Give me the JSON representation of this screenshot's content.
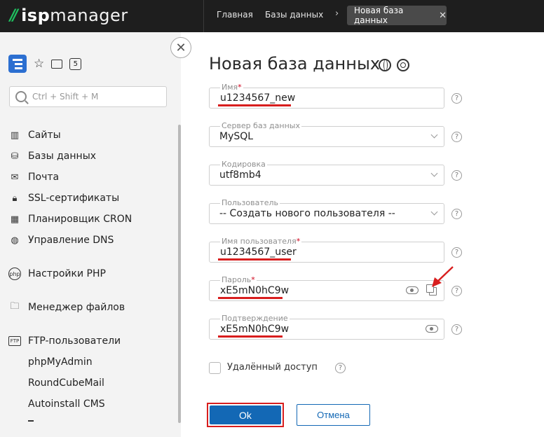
{
  "topbar": {
    "logo_mark": "//",
    "logo_isp": "isp",
    "logo_manager": "manager",
    "breadcrumbs": [
      "Главная",
      "Базы данных"
    ],
    "active_tab": "Новая база данных",
    "tab_close": "✕"
  },
  "sidebar": {
    "count_badge": "5",
    "search_placeholder": "Ctrl + Shift + M",
    "items": [
      {
        "label": "Сайты",
        "icon": "sites-icon"
      },
      {
        "label": "Базы данных",
        "icon": "database-icon"
      },
      {
        "label": "Почта",
        "icon": "mail-icon"
      },
      {
        "label": "SSL-сертификаты",
        "icon": "lock-icon"
      },
      {
        "label": "Планировщик CRON",
        "icon": "calendar-icon"
      },
      {
        "label": "Управление DNS",
        "icon": "dns-globe-icon"
      },
      {
        "label": "Настройки PHP",
        "icon": "php-icon"
      },
      {
        "label": "Менеджер файлов",
        "icon": "folder-icon"
      },
      {
        "label": "FTP-пользователи",
        "icon": "ftp-icon"
      },
      {
        "label": "phpMyAdmin",
        "icon": ""
      },
      {
        "label": "RoundCubeMail",
        "icon": ""
      },
      {
        "label": "Autoinstall CMS",
        "icon": ""
      }
    ]
  },
  "form": {
    "title": "Новая база данных",
    "close_symbol": "✕",
    "required_mark": "*",
    "help_symbol": "?",
    "fields": {
      "name": {
        "label": "Имя",
        "value": "u1234567_new"
      },
      "server": {
        "label": "Сервер баз данных",
        "value": "MySQL"
      },
      "charset": {
        "label": "Кодировка",
        "value": "utf8mb4"
      },
      "user": {
        "label": "Пользователь",
        "value": "-- Создать нового пользователя --"
      },
      "username": {
        "label": "Имя пользователя",
        "value": "u1234567_user"
      },
      "password": {
        "label": "Пароль",
        "value": "xE5mN0hC9w"
      },
      "confirm": {
        "label": "Подтверждение",
        "value": "xE5mN0hC9w"
      }
    },
    "remote_access_label": "Удалённый доступ",
    "ok_label": "Ok",
    "cancel_label": "Отмена"
  },
  "colors": {
    "topbar_bg": "#1e1e1e",
    "logo_green": "#1fbf5f",
    "accent_blue": "#1368b5",
    "sidebar_tool_blue": "#2c6fd1",
    "annotation_red": "#d81e1e",
    "sidebar_bg": "#f3f3f3"
  }
}
